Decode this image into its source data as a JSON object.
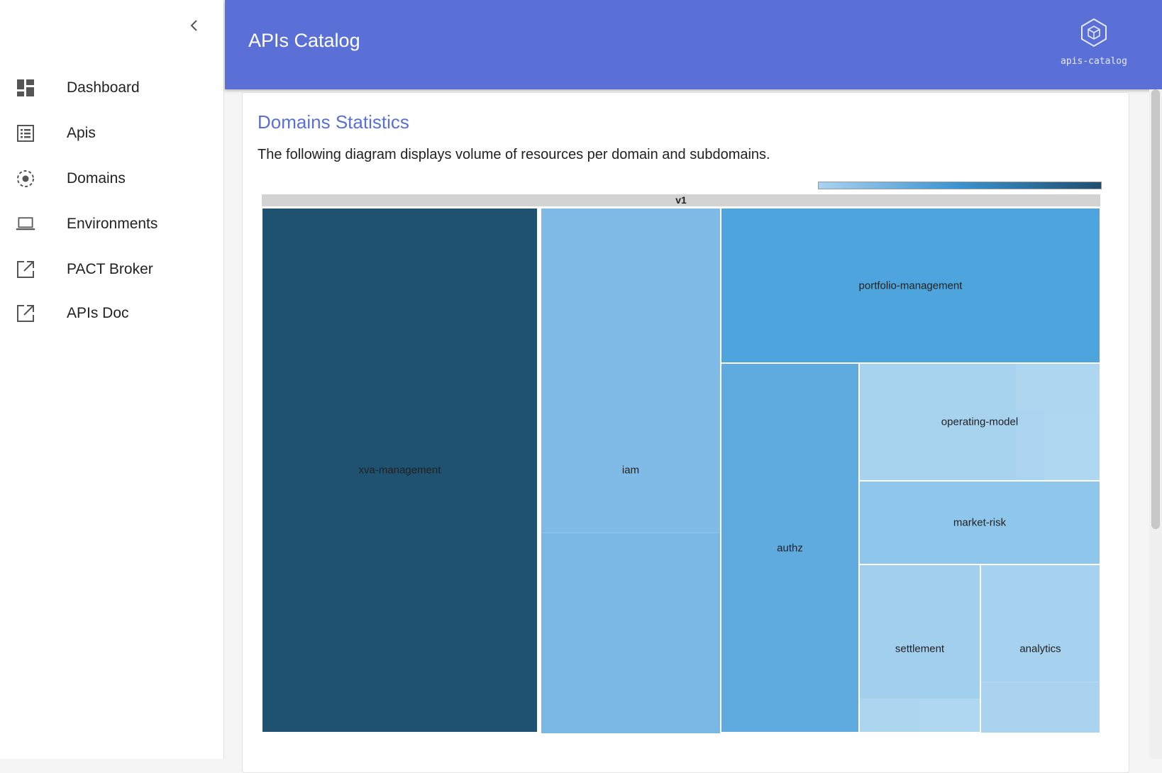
{
  "sidebar": {
    "items": [
      {
        "label": "Dashboard",
        "icon": "dashboard-icon"
      },
      {
        "label": "Apis",
        "icon": "list-icon"
      },
      {
        "label": "Domains",
        "icon": "domains-icon"
      },
      {
        "label": "Environments",
        "icon": "laptop-icon"
      },
      {
        "label": "PACT Broker",
        "icon": "external-link-icon"
      },
      {
        "label": "APIs Doc",
        "icon": "external-link-icon"
      }
    ]
  },
  "header": {
    "title": "APIs Catalog",
    "brand": "apis-catalog",
    "color": "#5a70d6"
  },
  "card": {
    "title": "Domains Statistics",
    "description": "The following diagram displays volume of resources per domain and subdomains."
  },
  "chart_data": {
    "type": "treemap",
    "root": "v1",
    "domains": [
      {
        "name": "xva-management",
        "color": "#1f5170"
      },
      {
        "name": "iam",
        "color": "#7fbbe6"
      },
      {
        "name": "portfolio-management",
        "color": "#4ea4dc"
      },
      {
        "name": "authz",
        "color": "#5fabe0"
      },
      {
        "name": "operating-model",
        "color": "#a8d3ef"
      },
      {
        "name": "market-risk",
        "color": "#8ec6ec"
      },
      {
        "name": "settlement",
        "color": "#a3cfee"
      },
      {
        "name": "analytics",
        "color": "#a6d1ef"
      }
    ],
    "legend": "color-scale",
    "colors": {
      "scale_low": "#a9d2ef",
      "scale_mid": "#3a93d0",
      "scale_high": "#1f4e6e"
    }
  }
}
